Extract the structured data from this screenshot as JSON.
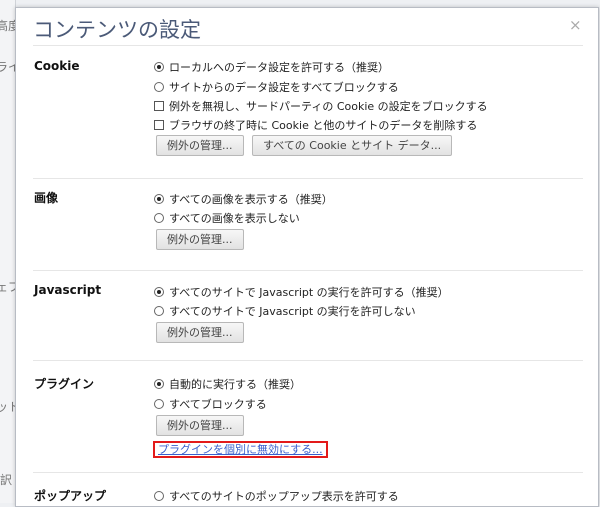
{
  "background": {
    "fragments": [
      "高度",
      "ライ",
      "ェブ",
      "ット",
      "訳"
    ]
  },
  "dialog": {
    "title": "コンテンツの設定",
    "close": "×"
  },
  "cookie": {
    "label": "Cookie",
    "options": [
      "ローカルへのデータ設定を許可する（推奨）",
      "サイトからのデータ設定をすべてブロックする"
    ],
    "checks": [
      "例外を無視し、サードパーティの Cookie の設定をブロックする",
      "ブラウザの終了時に Cookie と他のサイトのデータを削除する"
    ],
    "btn_exceptions": "例外の管理...",
    "btn_all": "すべての Cookie とサイト データ..."
  },
  "images": {
    "label": "画像",
    "options": [
      "すべての画像を表示する（推奨）",
      "すべての画像を表示しない"
    ],
    "btn_exceptions": "例外の管理..."
  },
  "javascript": {
    "label": "Javascript",
    "options": [
      "すべてのサイトで Javascript の実行を許可する（推奨）",
      "すべてのサイトで Javascript の実行を許可しない"
    ],
    "btn_exceptions": "例外の管理..."
  },
  "plugins": {
    "label": "プラグイン",
    "options": [
      "自動的に実行する（推奨）",
      "すべてブロックする"
    ],
    "btn_exceptions": "例外の管理...",
    "link": "プラグインを個別に無効にする..."
  },
  "popups": {
    "label": "ポップアップ",
    "options": [
      "すべてのサイトのポップアップ表示を許可する"
    ]
  }
}
